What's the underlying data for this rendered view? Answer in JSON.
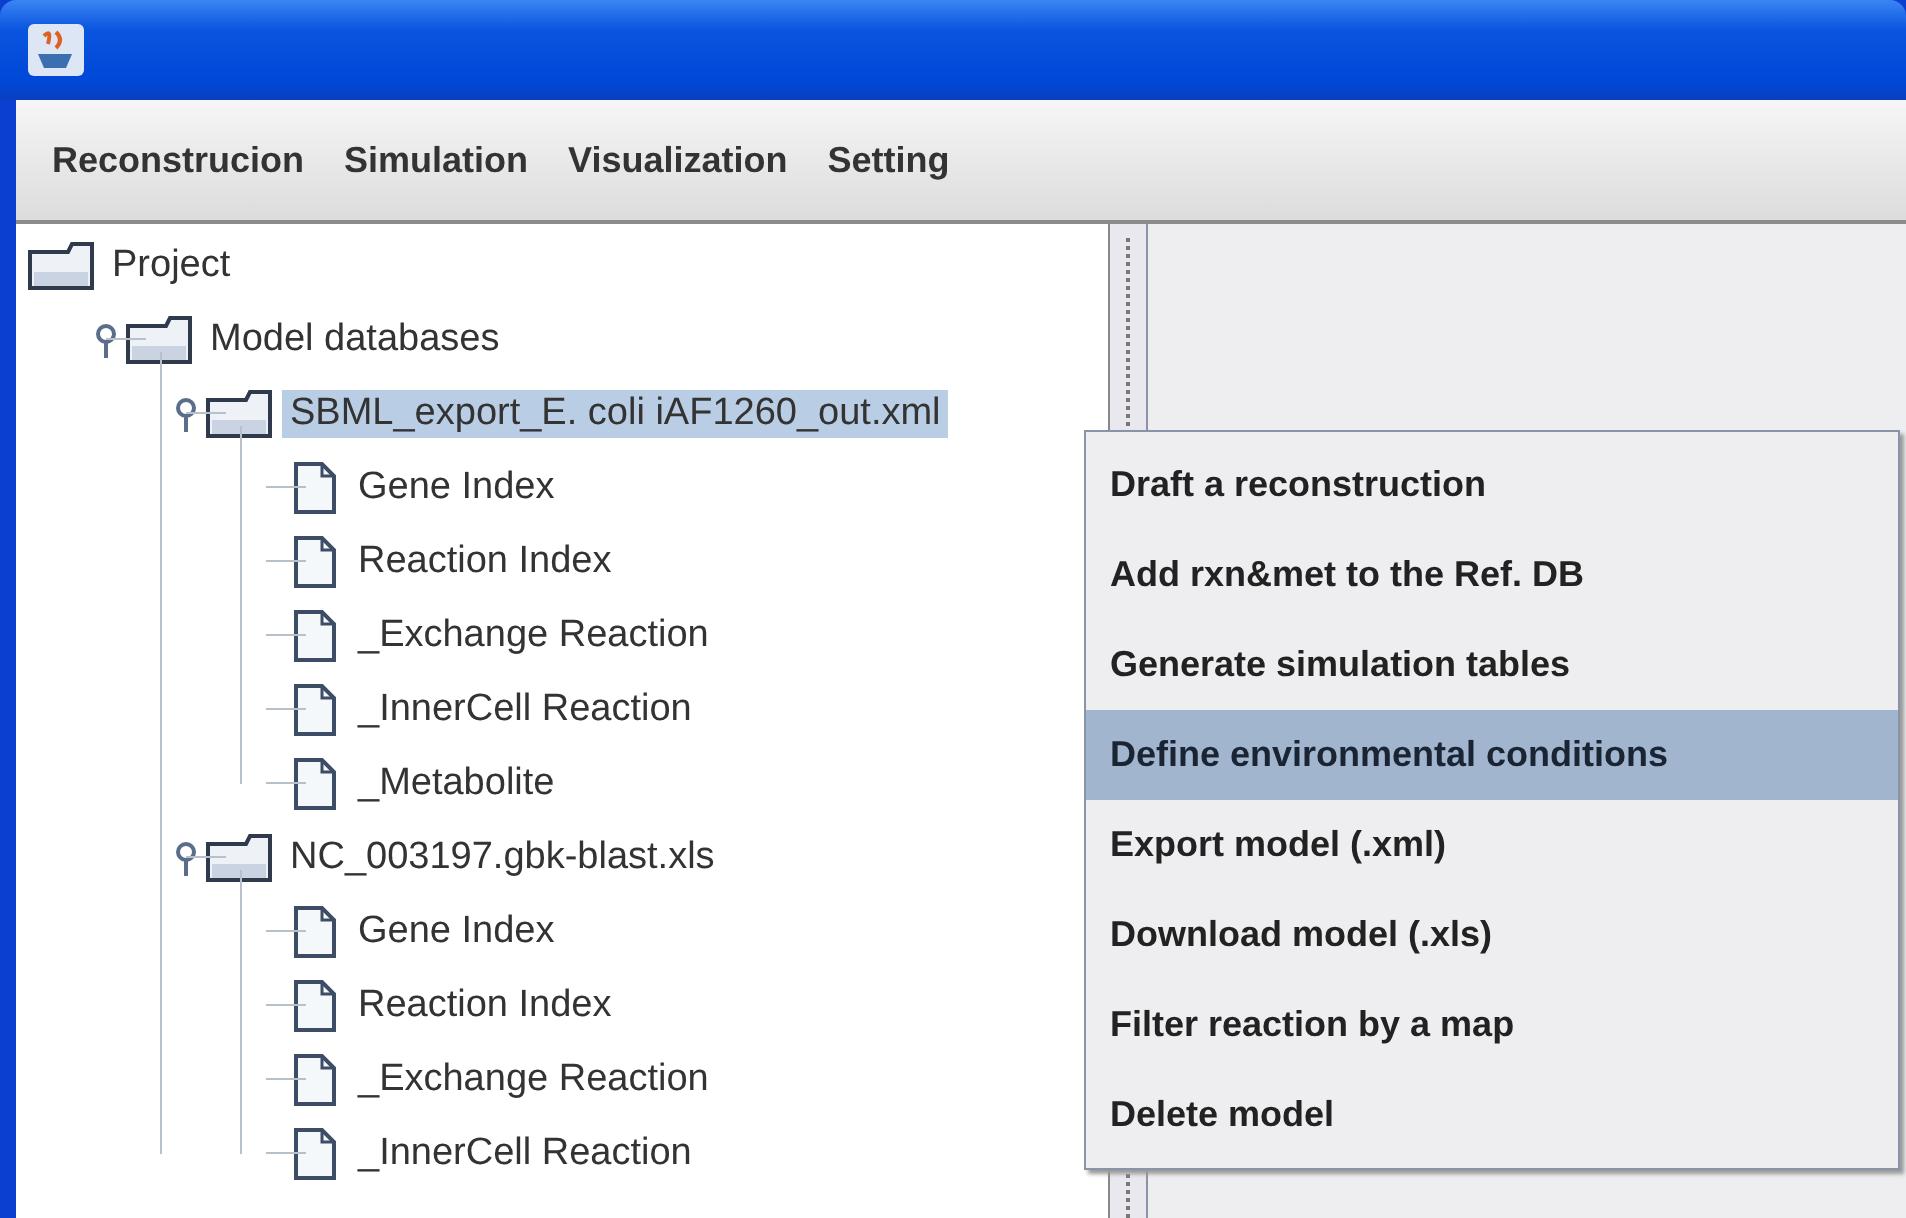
{
  "menu_bar": [
    {
      "label": "Reconstrucion"
    },
    {
      "label": "Simulation"
    },
    {
      "label": "Visualization"
    },
    {
      "label": "Setting"
    }
  ],
  "tree": [
    {
      "label": "Project",
      "kind": "folder",
      "selected": false,
      "children": [
        {
          "label": "Model databases",
          "kind": "folder",
          "expanded": true,
          "selected": false,
          "children": [
            {
              "label": "SBML_export_E. coli iAF1260_out.xml",
              "kind": "folder",
              "expanded": true,
              "selected": true,
              "children": [
                {
                  "label": "Gene Index",
                  "kind": "file",
                  "selected": false
                },
                {
                  "label": "Reaction Index",
                  "kind": "file",
                  "selected": false
                },
                {
                  "label": "_Exchange Reaction",
                  "kind": "file",
                  "selected": false
                },
                {
                  "label": "_InnerCell Reaction",
                  "kind": "file",
                  "selected": false
                },
                {
                  "label": "_Metabolite",
                  "kind": "file",
                  "selected": false
                }
              ]
            },
            {
              "label": "NC_003197.gbk-blast.xls",
              "kind": "folder",
              "expanded": true,
              "selected": false,
              "children": [
                {
                  "label": "Gene Index",
                  "kind": "file",
                  "selected": false
                },
                {
                  "label": "Reaction Index",
                  "kind": "file",
                  "selected": false
                },
                {
                  "label": "_Exchange Reaction",
                  "kind": "file",
                  "selected": false
                },
                {
                  "label": "_InnerCell Reaction",
                  "kind": "file",
                  "selected": false
                }
              ]
            }
          ]
        }
      ]
    }
  ],
  "context_menu": [
    {
      "label": "Draft a reconstruction",
      "selected": false
    },
    {
      "label": "Add rxn&met to the Ref. DB",
      "selected": false
    },
    {
      "label": "Generate simulation tables",
      "selected": false
    },
    {
      "label": "Define environmental conditions",
      "selected": true
    },
    {
      "label": "Export model (.xml)",
      "selected": false
    },
    {
      "label": "Download model (.xls)",
      "selected": false
    },
    {
      "label": "Filter reaction by a map",
      "selected": false
    },
    {
      "label": "Delete model",
      "selected": false
    }
  ]
}
